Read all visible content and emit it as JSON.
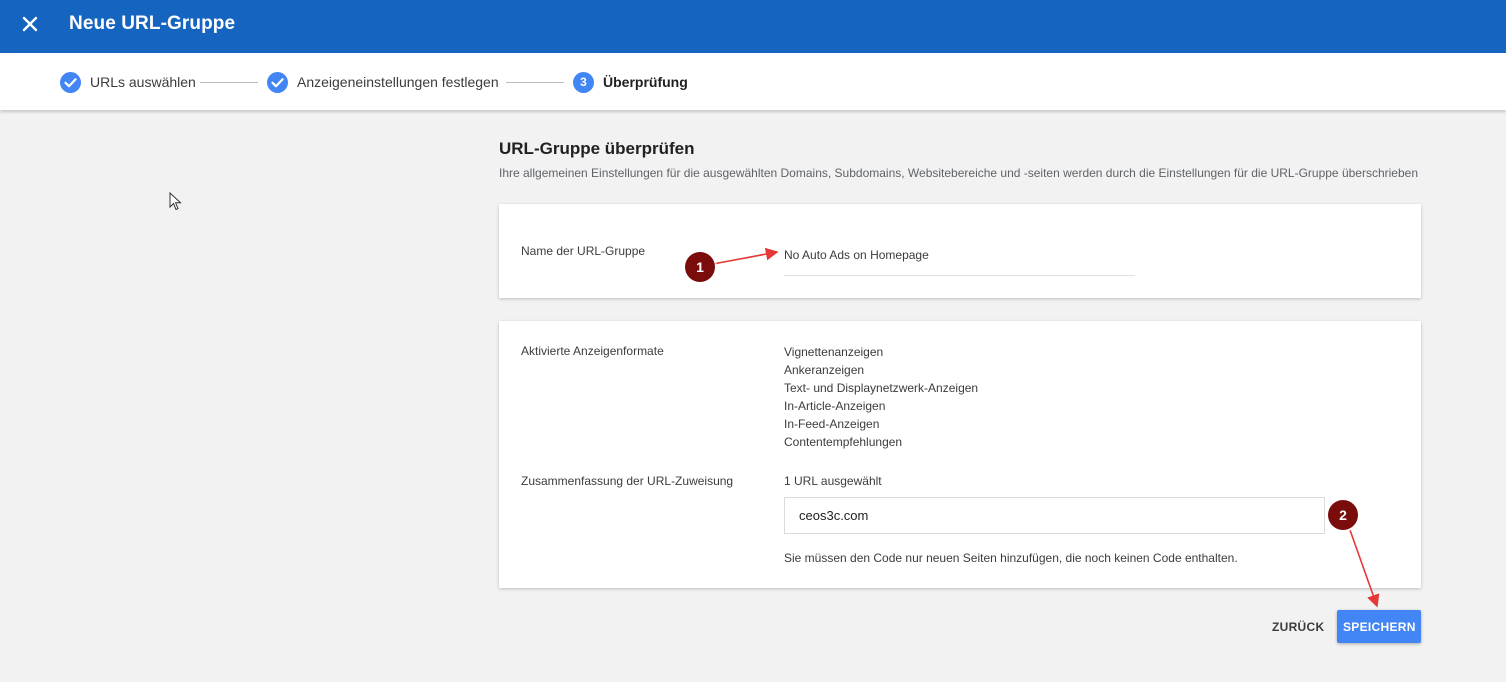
{
  "topbar": {
    "title": "Neue URL-Gruppe",
    "close_icon": "close-icon",
    "background": "#1565c0"
  },
  "stepper": {
    "steps": [
      {
        "label": "URLs auswählen",
        "state": "done",
        "icon": "check-icon"
      },
      {
        "label": "Anzeigeneinstellungen festlegen",
        "state": "done",
        "icon": "check-icon"
      },
      {
        "label": "Überprüfung",
        "state": "active",
        "number": "3"
      }
    ],
    "accent": "#4285f4"
  },
  "main": {
    "title": "URL-Gruppe überprüfen",
    "subtitle": "Ihre allgemeinen Einstellungen für die ausgewählten Domains, Subdomains, Websitebereiche und -seiten werden durch die Einstellungen für die URL-Gruppe überschrieben"
  },
  "name_card": {
    "label": "Name der URL-Gruppe",
    "value": "No Auto Ads on Homepage"
  },
  "settings_card": {
    "formats_label": "Aktivierte Anzeigenformate",
    "formats": [
      "Vignettenanzeigen",
      "Ankeranzeigen",
      "Text- und Displaynetzwerk-Anzeigen",
      "In-Article-Anzeigen",
      "In-Feed-Anzeigen",
      "Contentempfehlungen"
    ],
    "assignment_label": "Zusammenfassung der URL-Zuweisung",
    "assignment_count": "1 URL ausgewählt",
    "url": "ceos3c.com",
    "hint": "Sie müssen den Code nur neuen Seiten hinzufügen, die noch keinen Code enthalten."
  },
  "actions": {
    "back_label": "ZURÜCK",
    "save_label": "SPEICHERN",
    "save_color": "#4285f4"
  },
  "annotations": {
    "marker1": "1",
    "marker2": "2",
    "marker_color": "#7b0c0c",
    "arrow_color": "#e53935"
  },
  "cursor": {
    "icon": "mouse-pointer-icon"
  }
}
